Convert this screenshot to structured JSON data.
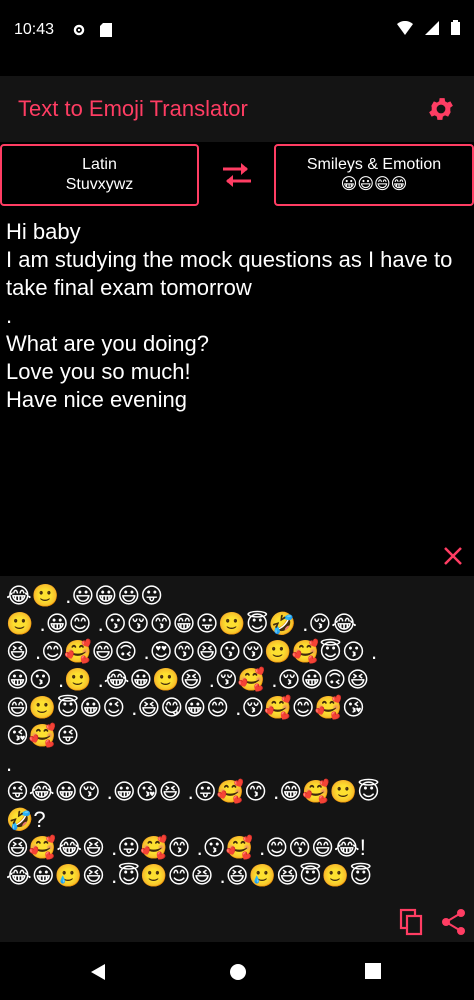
{
  "status": {
    "time": "10:43"
  },
  "app": {
    "title": "Text to Emoji Translator",
    "accent": "#ff3d63"
  },
  "source_language": {
    "name": "Latin",
    "sample": "Stuvxywz"
  },
  "target_language": {
    "name": "Smileys & Emotion",
    "sample": "😀😃😄😁"
  },
  "input_text": "Hi baby\nI am studying the mock questions as I have to take final exam tomorrow\n.\nWhat are you doing?\nLove you so much!\nHave nice evening",
  "output_text": "😂🙂 .😃😀😃😛\n🙂 .😀😊 .😗😚😙😁😛🙂😇🤣 .😚😂\n😆 .😊🥰😄🙃 .😍😙😆😗😚🙂🥰😇😗 .\n😀😗 .🙂 .😂😀🙂😆 .😚🥰 .😚😀🙃😆\n😄🙂😇😀😉 .😆😋😀😊 .😚🥰😊🥰😘\n😘🥰😜\n.\n😜😂😀😚 .😀😘😆 .😛🥰😙 .😁🥰🙂😇\n🤣?\n😆🥰😂😆 .😛🥰😙 .😗🥰 .😊😙😄😂!\n😂😀🥲😆 .😇🙂😊😆 .😆🥲😆😇🙂😇",
  "icons": {
    "settings": "gear-icon",
    "swap": "swap-arrows-icon",
    "clear": "close-icon",
    "copy": "copy-icon",
    "share": "share-icon"
  }
}
